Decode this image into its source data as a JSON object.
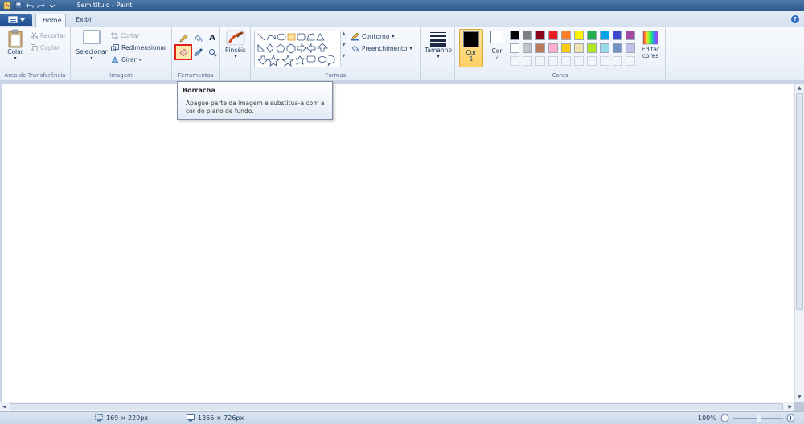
{
  "window": {
    "title": "Sem título - Paint"
  },
  "tabs": [
    {
      "label": "Home"
    },
    {
      "label": "Exibir"
    }
  ],
  "help_glyph": "?",
  "groups": {
    "clipboard": {
      "label": "Área de Transferência",
      "paste": "Colar",
      "cut": "Recortar",
      "copy": "Copiar"
    },
    "image": {
      "label": "Imagem",
      "select": "Selecionar",
      "crop": "Cortar",
      "resize": "Redimensionar",
      "rotate": "Girar"
    },
    "tools": {
      "label": "Ferramentas",
      "text_glyph": "A"
    },
    "brushes": {
      "label": "Pincéis"
    },
    "shapes": {
      "label": "Formas",
      "outline": "Contorno",
      "fill": "Preenchimento"
    },
    "size": {
      "label": "Tamanho"
    },
    "colors": {
      "label": "Cores",
      "color1_line1": "Cor",
      "color1_line2": "1",
      "color2_line1": "Cor",
      "color2_line2": "2",
      "edit_line1": "Editar",
      "edit_line2": "cores",
      "color1_value": "#000000",
      "color2_value": "#ffffff",
      "palette_row1": [
        "#000000",
        "#7f7f7f",
        "#880015",
        "#ed1c24",
        "#ff7f27",
        "#fff200",
        "#22b14c",
        "#00a2e8",
        "#3f48cc",
        "#a349a4"
      ],
      "palette_row2": [
        "#ffffff",
        "#c3c3c3",
        "#b97a57",
        "#ffaec9",
        "#ffc90e",
        "#efe4b0",
        "#b5e61d",
        "#99d9ea",
        "#7092be",
        "#c8bfe7"
      ]
    }
  },
  "tooltip": {
    "title": "Borracha",
    "body": "Apague parte da imagem e substitua-a com a cor do plano de fundo."
  },
  "status": {
    "selection_size": "169 × 229px",
    "canvas_size": "1366 × 726px",
    "zoom": "100%"
  }
}
